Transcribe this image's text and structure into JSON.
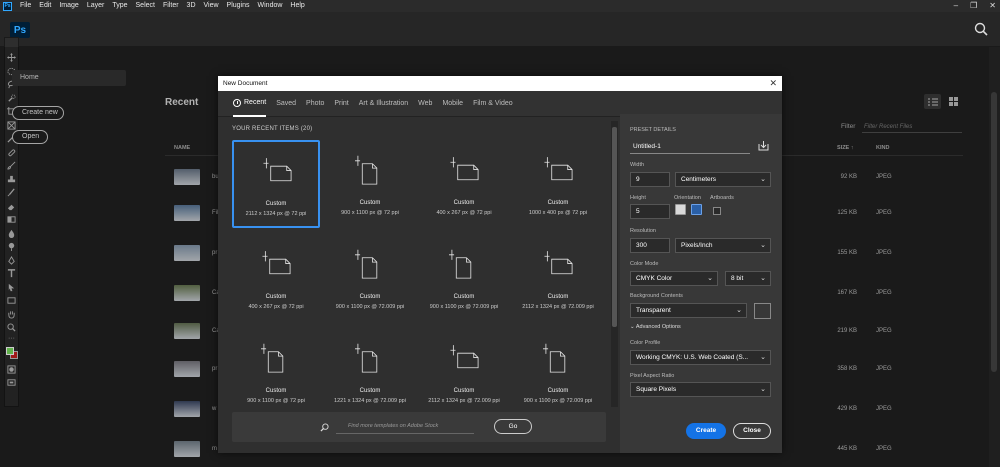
{
  "menubar": {
    "app_badge": "Ps",
    "items": [
      "File",
      "Edit",
      "Image",
      "Layer",
      "Type",
      "Select",
      "Filter",
      "3D",
      "View",
      "Plugins",
      "Window",
      "Help"
    ],
    "window_controls": [
      "–",
      "❐",
      "✕"
    ]
  },
  "topbar": {
    "logo": "Ps"
  },
  "toolbar": {
    "collapse": "›› ›"
  },
  "home": {
    "home_label": "Home",
    "create_new_label": "Create new",
    "open_label": "Open",
    "recent_title": "Recent",
    "filter_label": "Filter",
    "filter_placeholder": "Filter Recent Files",
    "columns": {
      "name": "NAME",
      "size": "SIZE",
      "kind": "KIND"
    },
    "files": [
      {
        "name": "bu",
        "size": "92 KB",
        "kind": "JPEG"
      },
      {
        "name": "Fil",
        "size": "125 KB",
        "kind": "JPEG"
      },
      {
        "name": "pr",
        "size": "155 KB",
        "kind": "JPEG"
      },
      {
        "name": "Ca",
        "size": "167 KB",
        "kind": "JPEG"
      },
      {
        "name": "Ca",
        "size": "219 KB",
        "kind": "JPEG"
      },
      {
        "name": "pr",
        "size": "358 KB",
        "kind": "JPEG"
      },
      {
        "name": "w",
        "size": "429 KB",
        "kind": "JPEG"
      },
      {
        "name": "m",
        "size": "445 KB",
        "kind": "JPEG"
      }
    ]
  },
  "dialog": {
    "title": "New Document",
    "close": "✕",
    "tabs": [
      "Recent",
      "Saved",
      "Photo",
      "Print",
      "Art & Illustration",
      "Web",
      "Mobile",
      "Film & Video"
    ],
    "recent_heading": "YOUR RECENT ITEMS  (20)",
    "items": [
      {
        "label": "Custom",
        "dims": "2112 x 1324 px @ 72 ppi",
        "shape": "landscape",
        "selected": true
      },
      {
        "label": "Custom",
        "dims": "900 x 1100 px @ 72 ppi",
        "shape": "portrait",
        "selected": false
      },
      {
        "label": "Custom",
        "dims": "400 x 267 px @ 72 ppi",
        "shape": "landscape",
        "selected": false
      },
      {
        "label": "Custom",
        "dims": "1000 x 400 px @ 72 ppi",
        "shape": "landscape",
        "selected": false
      },
      {
        "label": "Custom",
        "dims": "400 x 267 px @ 72 ppi",
        "shape": "landscape",
        "selected": false
      },
      {
        "label": "Custom",
        "dims": "900 x 1100 px @ 72.009 ppi",
        "shape": "portrait",
        "selected": false
      },
      {
        "label": "Custom",
        "dims": "900 x 1100 px @ 72.009 ppi",
        "shape": "portrait",
        "selected": false
      },
      {
        "label": "Custom",
        "dims": "2112 x 1324 px @ 72.009 ppi",
        "shape": "landscape",
        "selected": false
      },
      {
        "label": "Custom",
        "dims": "900 x 1100 px @ 72 ppi",
        "shape": "portrait",
        "selected": false
      },
      {
        "label": "Custom",
        "dims": "1221 x 1324 px @ 72.009 ppi",
        "shape": "portrait",
        "selected": false
      },
      {
        "label": "Custom",
        "dims": "2112 x 1324 px @ 72.009 ppi",
        "shape": "landscape",
        "selected": false
      },
      {
        "label": "Custom",
        "dims": "900 x 1100 px @ 72.009 ppi",
        "shape": "portrait",
        "selected": false
      }
    ],
    "stock_placeholder": "Find more templates on Adobe Stock",
    "go_label": "Go",
    "preset": {
      "heading": "PRESET DETAILS",
      "name": "Untitled-1",
      "width_label": "Width",
      "width_value": "9",
      "width_unit": "Centimeters",
      "height_label": "Height",
      "height_value": "5",
      "orientation_label": "Orientation",
      "artboards_label": "Artboards",
      "resolution_label": "Resolution",
      "resolution_value": "300",
      "resolution_unit": "Pixels/Inch",
      "color_mode_label": "Color Mode",
      "color_mode": "CMYK Color",
      "bit_depth": "8 bit",
      "bg_label": "Background Contents",
      "bg_value": "Transparent",
      "advanced_label": "Advanced Options",
      "profile_label": "Color Profile",
      "profile_value": "Working CMYK: U.S. Web Coated (S...",
      "aspect_label": "Pixel Aspect Ratio",
      "aspect_value": "Square Pixels",
      "create_label": "Create",
      "close_label": "Close"
    }
  },
  "colors": {
    "accent": "#1473e6",
    "selection": "#3891f0",
    "foreground_swatch": "#61b24c",
    "background_swatch": "#d42121"
  }
}
